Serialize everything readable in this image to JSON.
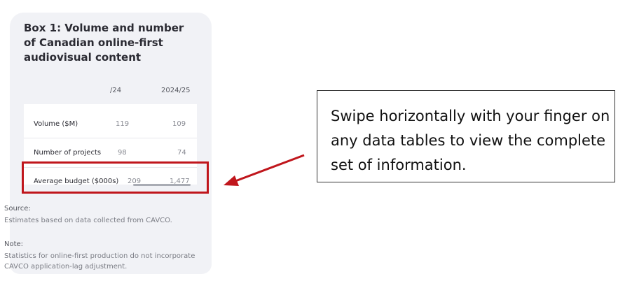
{
  "box": {
    "title": "Box 1: Volume and number of Canadian online-first audiovisual content"
  },
  "table": {
    "headers": [
      "",
      "/24",
      "2024/25"
    ],
    "rows": [
      {
        "label": "Volume ($M)",
        "prev": "119",
        "curr": "109"
      },
      {
        "label": "Number of projects",
        "prev": "98",
        "curr": "74"
      },
      {
        "label": "Average budget ($000s)",
        "prev": "209",
        "curr": "1,477"
      }
    ]
  },
  "source": {
    "label": "Source:",
    "text": "Estimates based on data collected from CAVCO."
  },
  "note": {
    "label": "Note:",
    "text": "Statistics for online-first production do not incorporate CAVCO application-lag adjustment."
  },
  "callout": {
    "text": "Swipe horizontally with your finger on any data tables to view the complete set of information."
  },
  "colors": {
    "highlight": "#c0161c",
    "card_bg": "#f1f2f6"
  }
}
